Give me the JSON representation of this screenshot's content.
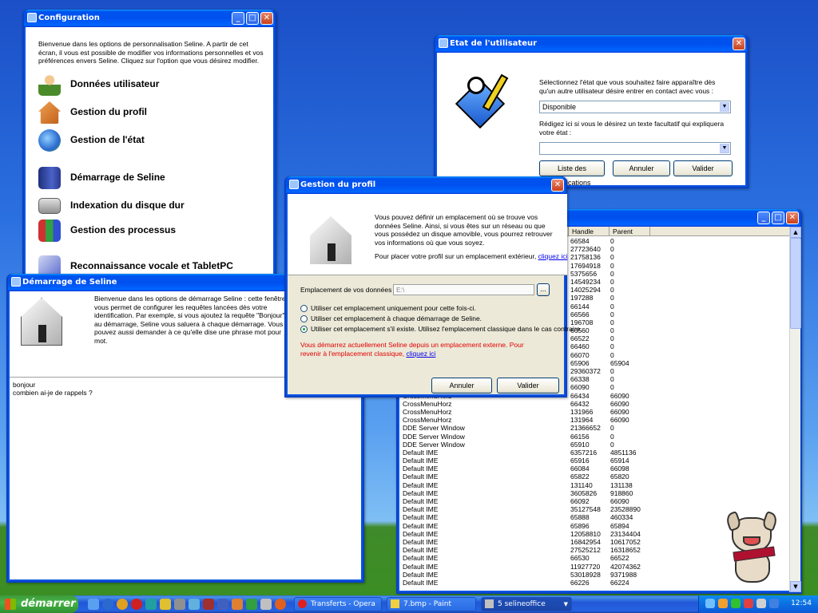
{
  "config": {
    "title": "Configuration",
    "intro": "Bienvenue dans les options de personnalisation Seline. A partir de cet écran, il vous est possible de modifier vos informations personnelles et vos préférences envers Seline. Cliquez sur l'option que vous désirez modifier.",
    "items": [
      {
        "label": "Données utilisateur",
        "icon": "user-icon",
        "color": "#4a8a2a"
      },
      {
        "label": "Gestion du profil",
        "icon": "home-icon",
        "color": "#d07a2a"
      },
      {
        "label": "Gestion de l'état",
        "icon": "globe-icon",
        "color": "#2a7ad0"
      },
      {
        "label": "Démarrage de Seline",
        "icon": "book-icon",
        "color": "#3a52a8"
      },
      {
        "label": "Indexation du disque dur",
        "icon": "drive-icon",
        "color": "#808080"
      },
      {
        "label": "Gestion des processus",
        "icon": "blocks-icon",
        "color": "#2aa04a"
      },
      {
        "label": "Reconnaissance vocale et TabletPC",
        "icon": "tools-icon",
        "color": "#5a6ad0"
      }
    ]
  },
  "etat": {
    "title": "Etat de l'utilisateur",
    "prompt1": "Sélectionnez l'état que vous souhaitez faire apparaître dès qu'un autre utilisateur désire entrer en contact avec vous :",
    "status_value": "Disponible",
    "prompt2": "Rédigez ici si vous le désirez un texte facultatif qui expliquera votre état :",
    "text_value": "",
    "btn_list": "Liste des explications",
    "btn_cancel": "Annuler",
    "btn_ok": "Valider"
  },
  "profil": {
    "title": "Gestion du profil",
    "desc": "Vous pouvez définir un emplacement où se trouve vos données Seline. Ainsi, si vous êtes sur un réseau ou que vous possédez un disque amovible, vous pourrez retrouver vos informations où que vous soyez.",
    "place_text": "Pour placer votre profil sur un emplacement extérieur,",
    "place_link": "cliquez ici",
    "location_label": "Emplacement de vos données :",
    "location_value": "E:\\",
    "browse": "...",
    "radio1": "Utiliser cet emplacement uniquement pour cette fois-ci.",
    "radio2": "Utiliser cet emplacement à chaque démarrage de Seline.",
    "radio3": "Utiliser cet emplacement s'il existe. Utilisez l'emplacement classique dans le cas contraire.",
    "warning": "Vous démarrez actuellement Seline depuis un emplacement externe. Pour revenir à l'emplacement classique,",
    "warning_link": "cliquez ici",
    "btn_cancel": "Annuler",
    "btn_ok": "Valider"
  },
  "demarrage": {
    "title": "Démarrage de Seline",
    "desc": "Bienvenue dans les options de démarrage Seline : cette fenêtre vous permet de configurer les requêtes lancées dès votre identification. Par exemple, si vous ajoutez la requête \"Bonjour\" au démarrage, Seline vous saluera à chaque démarrage. Vous pouvez aussi demander à ce qu'elle dise une phrase mot pour mot.",
    "lines": [
      "bonjour",
      "combien ai-je de rappels ?"
    ]
  },
  "process": {
    "headers": [
      "Handle",
      "Parent"
    ],
    "rows": [
      [
        "",
        "66584",
        "0"
      ],
      [
        "",
        "27723640",
        "0"
      ],
      [
        "",
        "21758136",
        "0"
      ],
      [
        "",
        "17694918",
        "0"
      ],
      [
        "",
        "5375656",
        "0"
      ],
      [
        "",
        "14549234",
        "0"
      ],
      [
        "",
        "14025294",
        "0"
      ],
      [
        "",
        "197288",
        "0"
      ],
      [
        "",
        "66144",
        "0"
      ],
      [
        "",
        "66566",
        "0"
      ],
      [
        "",
        "196708",
        "0"
      ],
      [
        "",
        "66560",
        "0"
      ],
      [
        "",
        "66522",
        "0"
      ],
      [
        "",
        "66460",
        "0"
      ],
      [
        "",
        "66070",
        "0"
      ],
      [
        "",
        "65906",
        "65904"
      ],
      [
        "",
        "29360372",
        "0"
      ],
      [
        "",
        "66338",
        "0"
      ],
      [
        "",
        "66090",
        "0"
      ],
      [
        "CrossMenuHorz",
        "66434",
        "66090"
      ],
      [
        "CrossMenuHorz",
        "66432",
        "66090"
      ],
      [
        "CrossMenuHorz",
        "131966",
        "66090"
      ],
      [
        "CrossMenuHorz",
        "131964",
        "66090"
      ],
      [
        "DDE Server Window",
        "21366652",
        "0"
      ],
      [
        "DDE Server Window",
        "66156",
        "0"
      ],
      [
        "DDE Server Window",
        "65910",
        "0"
      ],
      [
        "Default IME",
        "6357216",
        "4851136"
      ],
      [
        "Default IME",
        "65916",
        "65914"
      ],
      [
        "Default IME",
        "66084",
        "66098"
      ],
      [
        "Default IME",
        "65822",
        "65820"
      ],
      [
        "Default IME",
        "131140",
        "131138"
      ],
      [
        "Default IME",
        "3605826",
        "918860"
      ],
      [
        "Default IME",
        "66092",
        "66090"
      ],
      [
        "Default IME",
        "35127548",
        "23528890"
      ],
      [
        "Default IME",
        "65888",
        "460334"
      ],
      [
        "Default IME",
        "65896",
        "65894"
      ],
      [
        "Default IME",
        "12058810",
        "23134404"
      ],
      [
        "Default IME",
        "16842954",
        "10617052"
      ],
      [
        "Default IME",
        "27525212",
        "16318652"
      ],
      [
        "Default IME",
        "66530",
        "66522"
      ],
      [
        "Default IME",
        "11927720",
        "42074362"
      ],
      [
        "Default IME",
        "53018928",
        "9371988"
      ],
      [
        "Default IME",
        "66226",
        "66224"
      ]
    ]
  },
  "taskbar": {
    "start": "démarrer",
    "tasks": [
      "Transferts - Opera",
      "7.bmp - Paint",
      "5 selineoffice"
    ],
    "clock": "12:54"
  }
}
